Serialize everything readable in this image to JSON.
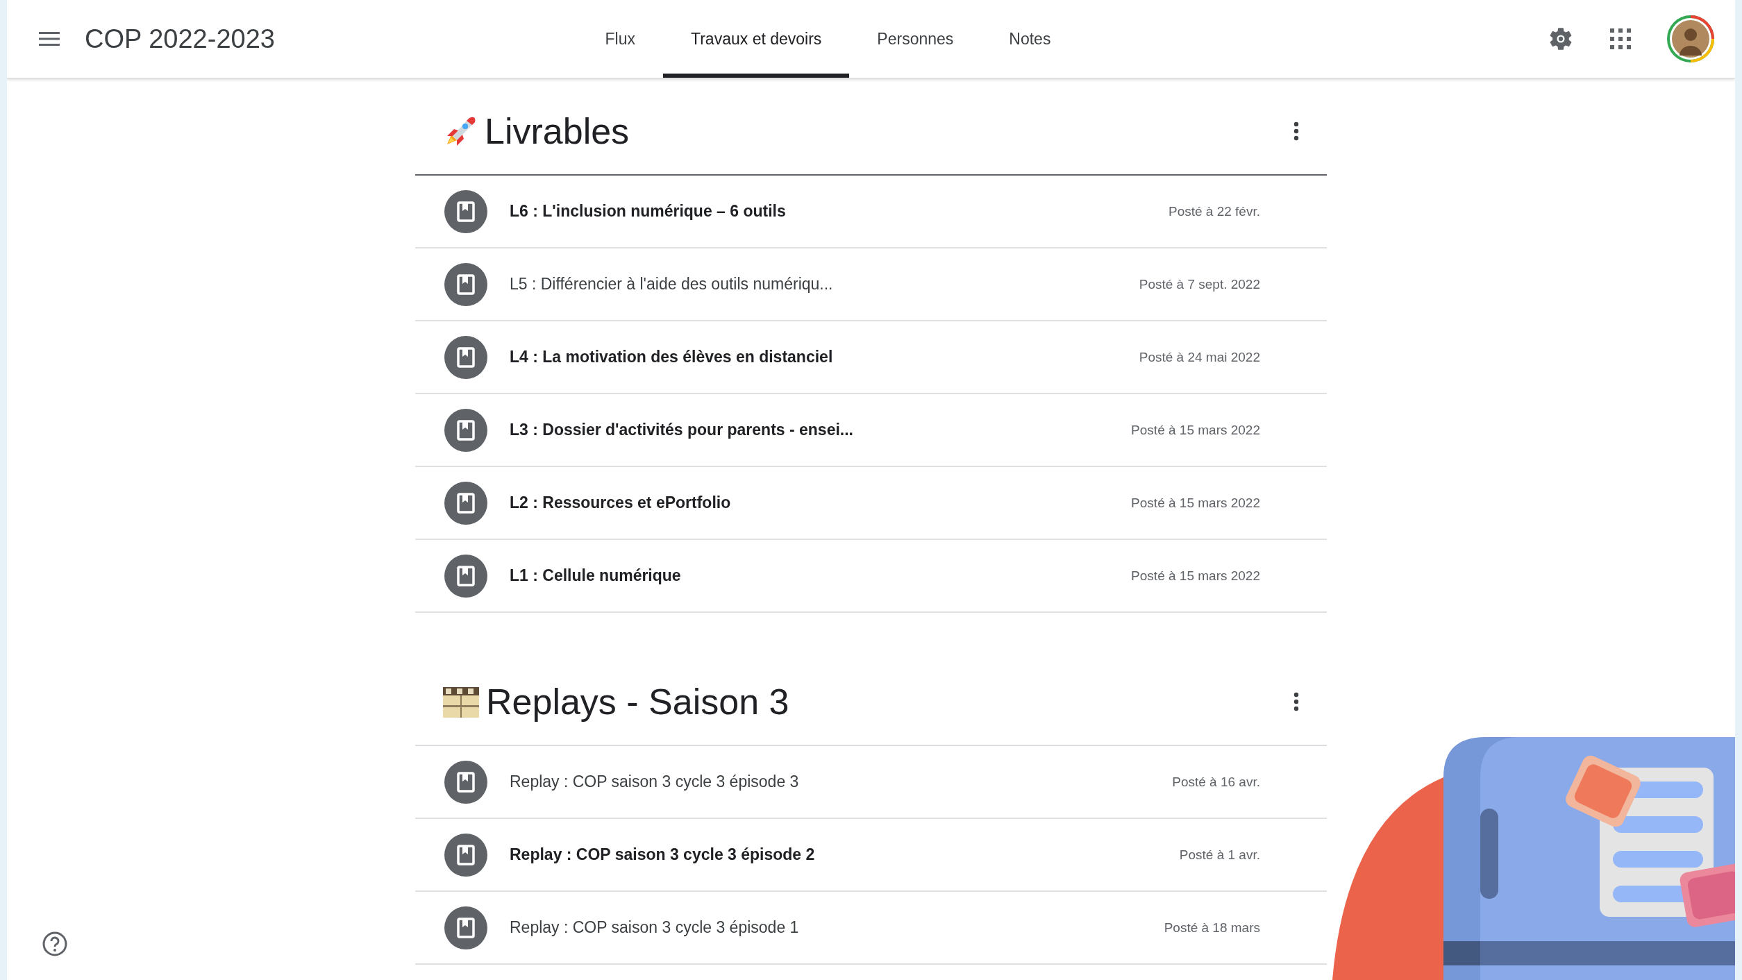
{
  "header": {
    "title": "COP 2022-2023"
  },
  "tabs": [
    {
      "label": "Flux",
      "selected": false
    },
    {
      "label": "Travaux et devoirs",
      "selected": true
    },
    {
      "label": "Personnes",
      "selected": false
    },
    {
      "label": "Notes",
      "selected": false
    }
  ],
  "sections": [
    {
      "kind": "rocket",
      "title": "Livrables",
      "items": [
        {
          "title": "L6 : L'inclusion numérique – 6 outils",
          "posted": "Posté à 22 févr.",
          "emphasized": true
        },
        {
          "title": "L5 : Différencier à l'aide des outils numériqu...",
          "posted": "Posté à 7 sept. 2022",
          "emphasized": false
        },
        {
          "title": "L4 : La motivation des élèves en distanciel",
          "posted": "Posté à 24 mai 2022",
          "emphasized": true
        },
        {
          "title": "L3 : Dossier d'activités pour parents - ensei...",
          "posted": "Posté à 15 mars 2022",
          "emphasized": true
        },
        {
          "title": "L2 : Ressources et ePortfolio",
          "posted": "Posté à 15 mars 2022",
          "emphasized": true
        },
        {
          "title": "L1 : Cellule numérique",
          "posted": "Posté à 15 mars 2022",
          "emphasized": true
        }
      ]
    },
    {
      "kind": "film",
      "title": "Replays - Saison 3",
      "items": [
        {
          "title": "Replay : COP saison 3 cycle 3 épisode 3",
          "posted": "Posté à 16 avr.",
          "emphasized": false
        },
        {
          "title": "Replay : COP saison 3 cycle 3 épisode 2",
          "posted": "Posté à 1 avr.",
          "emphasized": true
        },
        {
          "title": "Replay : COP saison 3 cycle 3 épisode 1",
          "posted": "Posté à 18 mars",
          "emphasized": false
        }
      ]
    }
  ]
}
